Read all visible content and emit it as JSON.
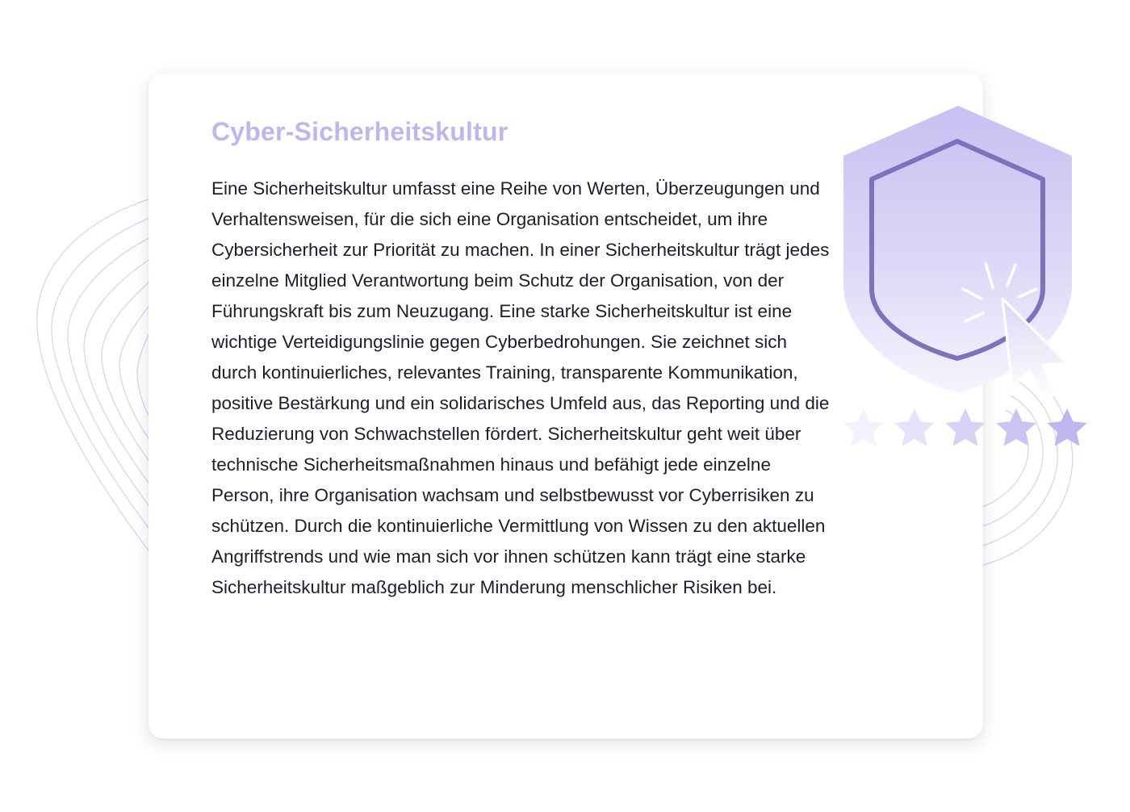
{
  "card": {
    "title": "Cyber-Sicherheitskultur",
    "body": "Eine Sicherheitskultur umfasst eine Reihe von Werten, Überzeugungen und Verhaltensweisen, für die sich eine Organisation entscheidet, um ihre Cybersicherheit zur Priorität zu machen. In einer Sicherheitskultur trägt jedes einzelne Mitglied Verantwortung beim Schutz der Organisation, von der Führungskraft bis zum Neuzugang. Eine starke Sicherheitskultur ist eine wichtige Verteidigungslinie gegen Cyberbedrohungen. Sie zeichnet sich durch kontinuierliches, relevantes Training, transparente Kommunikation, positive Bestärkung und ein solidarisches Umfeld aus, das Reporting und die Reduzierung von Schwachstellen fördert. Sicherheitskultur geht weit über technische Sicherheitsmaßnahmen hinaus und befähigt jede einzelne Person, ihre Organisation wachsam und selbstbewusst vor Cyberrisiken zu schützen. Durch die kontinuierliche Vermittlung von Wissen zu den aktuellen Angriffstrends und wie man sich vor ihnen schützen kann trägt eine starke Sicherheitskultur maßgeblich zur Minderung menschlicher Risiken bei."
  },
  "illustration": {
    "icons": [
      "shield-icon",
      "cursor-click-icon",
      "star-icon"
    ],
    "star_count": 5
  },
  "colors": {
    "accent": "#c0b6ef",
    "shield_fill": "#cdc6f2",
    "shield_outline": "#7f72bd",
    "text": "#1f1d2b",
    "background_lines": "#d8d3f5"
  }
}
